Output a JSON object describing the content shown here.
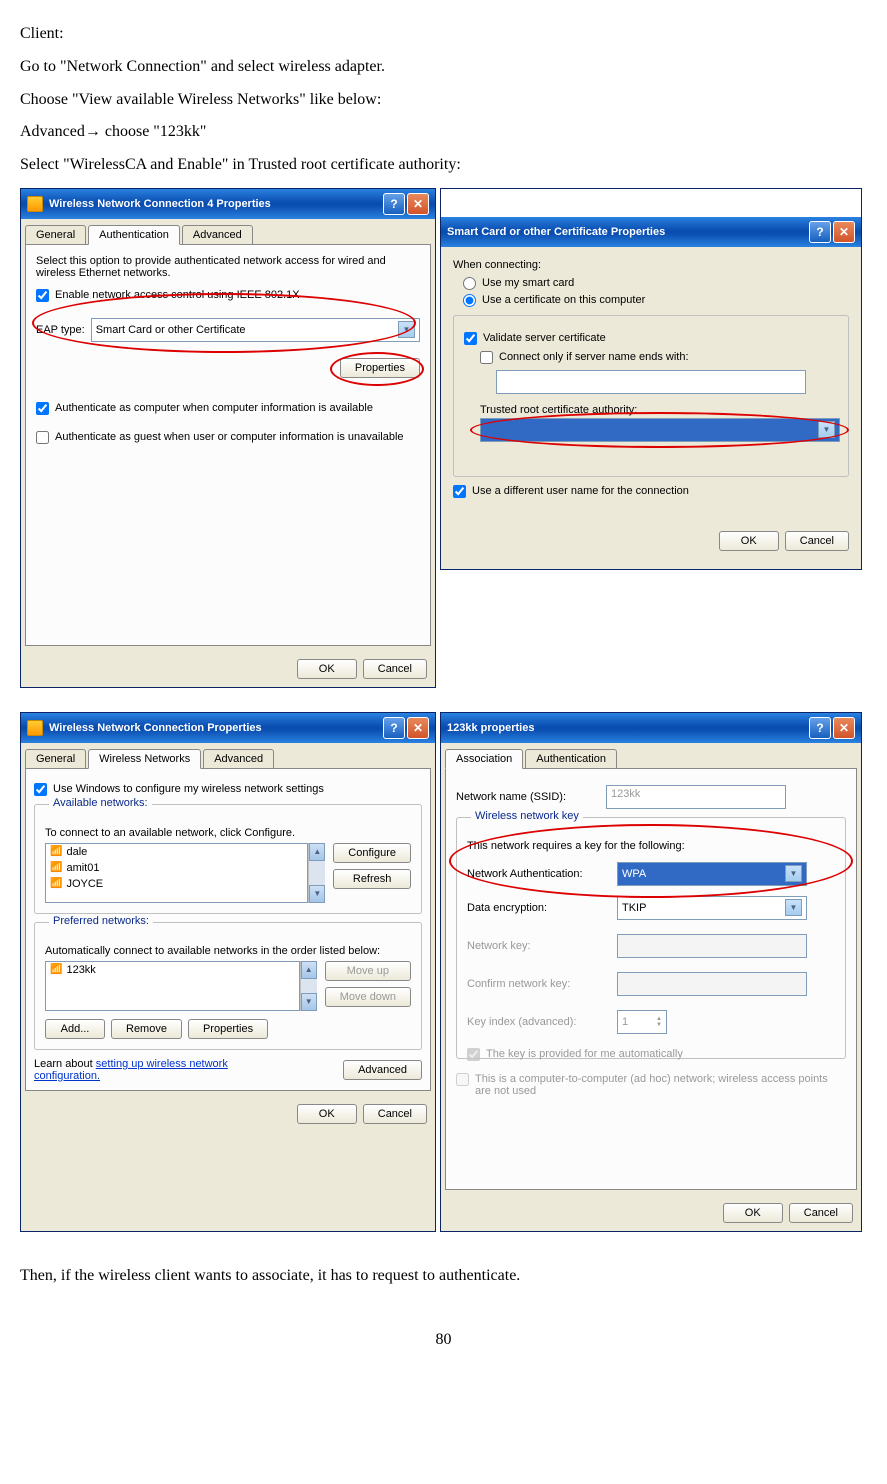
{
  "doc": {
    "line1": "Client:",
    "line2": "Go to \"Network Connection\" and select wireless adapter.",
    "line3": "Choose \"View available Wireless Networks\" like below:",
    "line4": "Advanced→ choose \"123kk\"",
    "line5": "Select \"WirelessCA and Enable\" in Trusted root certificate authority:",
    "line6": "Then, if the wireless client wants to associate, it has to request to authenticate.",
    "page": "80"
  },
  "dlg1": {
    "title": "Wireless Network Connection 4 Properties",
    "tabs": {
      "general": "General",
      "auth": "Authentication",
      "adv": "Advanced"
    },
    "desc": "Select this option to provide authenticated network access for wired and wireless Ethernet networks.",
    "enable_8021x": "Enable network access control using IEEE 802.1X",
    "eap_type_label": "EAP type:",
    "eap_type_value": "Smart Card or other Certificate",
    "properties_btn": "Properties",
    "auth_computer": "Authenticate as computer when computer information is available",
    "auth_guest": "Authenticate as guest when user or computer information is unavailable",
    "ok": "OK",
    "cancel": "Cancel"
  },
  "dlg2": {
    "title": "Smart Card or other Certificate Properties",
    "when_connecting": "When connecting:",
    "use_smartcard": "Use my smart card",
    "use_cert": "Use a certificate on this computer",
    "validate": "Validate server certificate",
    "connect_only": "Connect only if server name ends with:",
    "trusted_label": "Trusted root certificate authority:",
    "diff_user": "Use a different user name for the connection",
    "ok": "OK",
    "cancel": "Cancel"
  },
  "dlg3": {
    "title": "Wireless Network Connection Properties",
    "tabs": {
      "general": "General",
      "wireless": "Wireless Networks",
      "adv": "Advanced"
    },
    "use_windows": "Use Windows to configure my wireless network settings",
    "available_title": "Available networks:",
    "available_desc": "To connect to an available network, click Configure.",
    "networks": [
      "dale",
      "amit01",
      "JOYCE"
    ],
    "configure": "Configure",
    "refresh": "Refresh",
    "preferred_title": "Preferred networks:",
    "preferred_desc": "Automatically connect to available networks in the order listed below:",
    "preferred_item": "123kk",
    "moveup": "Move up",
    "movedown": "Move down",
    "add": "Add...",
    "remove": "Remove",
    "properties": "Properties",
    "learn": "Learn about ",
    "learn_link": "setting up wireless network configuration.",
    "advanced": "Advanced",
    "ok": "OK",
    "cancel": "Cancel"
  },
  "dlg4": {
    "title": "123kk properties",
    "tabs": {
      "assoc": "Association",
      "auth": "Authentication"
    },
    "ssid_label": "Network name (SSID):",
    "ssid_value": "123kk",
    "key_group": "Wireless network key",
    "key_desc": "This network requires a key for the following:",
    "net_auth_label": "Network Authentication:",
    "net_auth_value": "WPA",
    "data_enc_label": "Data encryption:",
    "data_enc_value": "TKIP",
    "net_key": "Network key:",
    "confirm_key": "Confirm network key:",
    "key_index": "Key index (advanced):",
    "key_index_value": "1",
    "key_auto": "The key is provided for me automatically",
    "adhoc": "This is a computer-to-computer (ad hoc) network; wireless access points are not used",
    "ok": "OK",
    "cancel": "Cancel"
  }
}
